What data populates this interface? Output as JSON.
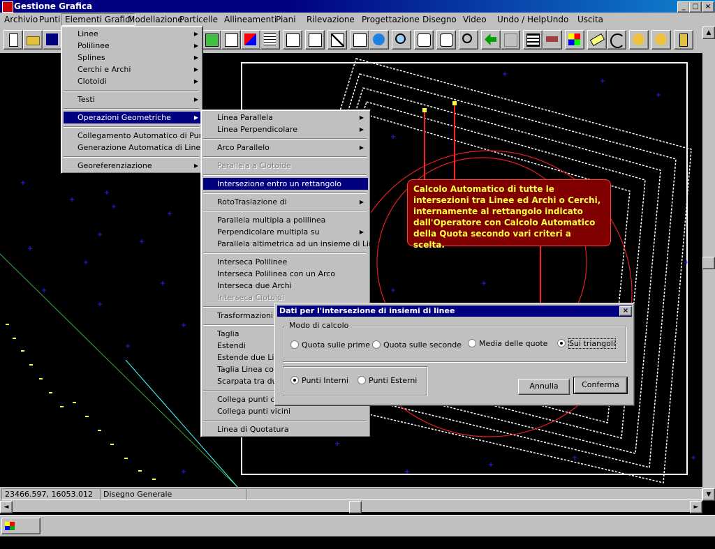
{
  "window": {
    "title": "Gestione Grafica",
    "min": "_",
    "max": "□",
    "close": "×"
  },
  "menubar": [
    "Archivio",
    "Punti",
    "Elementi Grafici",
    "Modellazione",
    "Particelle",
    "Allineamenti",
    "Piani",
    "Rilevazione",
    "Progettazione",
    "Disegno",
    "Video",
    "Undo / Help",
    "Undo",
    "Uscita"
  ],
  "menu1": {
    "items": [
      "Linee",
      "Polilinee",
      "Splines",
      "Cerchi e Archi",
      "Clotoidi",
      "Testi",
      "Operazioni Geometriche",
      "Collegamento Automatico di Punti",
      "Generazione Automatica di Linee",
      "Georeferenziazione"
    ]
  },
  "menu2": {
    "items": [
      "Linea Parallela",
      "Linea Perpendicolare",
      "Arco Parallelo",
      "Parallela a Clotoide",
      "Intersezione entro un rettangolo",
      "RotoTraslazione di",
      "Parallela multipla a polilinea",
      "Perpendicolare multipla su",
      "Parallela altimetrica ad un insieme di Linee",
      "Interseca Polilinee",
      "Interseca Polilinea con un Arco",
      "Interseca due Archi",
      "Interseca Clotoidi",
      "Trasformazioni da",
      "Taglia",
      "Estendi",
      "Estende due Line",
      "Taglia Linea con",
      "Scarpata tra due",
      "Collega punti con",
      "Collega punti vicini",
      "Linea di Quotatura"
    ]
  },
  "callout": {
    "text": "Calcolo Automatico di tutte le intersezioni tra Linee ed Archi o Cerchi, internamente al rettangolo indicato dall'Operatore con Calcolo Automatico della Quota secondo vari criteri a scelta."
  },
  "dialog": {
    "title": "Dati per l'intersezione di insiemi di linee",
    "close": "×",
    "group_label": "Modo di calcolo",
    "modes": [
      "Quota sulle prime",
      "Quota sulle seconde",
      "Media delle quote",
      "Sui triangoli"
    ],
    "points": [
      "Punti Interni",
      "Punti Esterni"
    ],
    "cancel": "Annulla",
    "confirm": "Conferma"
  },
  "status": {
    "coords": "23466.597,   16053.012",
    "drawing": "Disegno Generale"
  },
  "taskbar": {
    "start": "Start"
  },
  "scroll": {
    "up": "▲",
    "down": "▼",
    "left": "◄",
    "right": "►"
  },
  "colors": {
    "titlebar": "#000080",
    "callout_bg": "#800000",
    "callout_text": "#ffff40",
    "canvas": "#000000",
    "marker": "#0000ff"
  }
}
